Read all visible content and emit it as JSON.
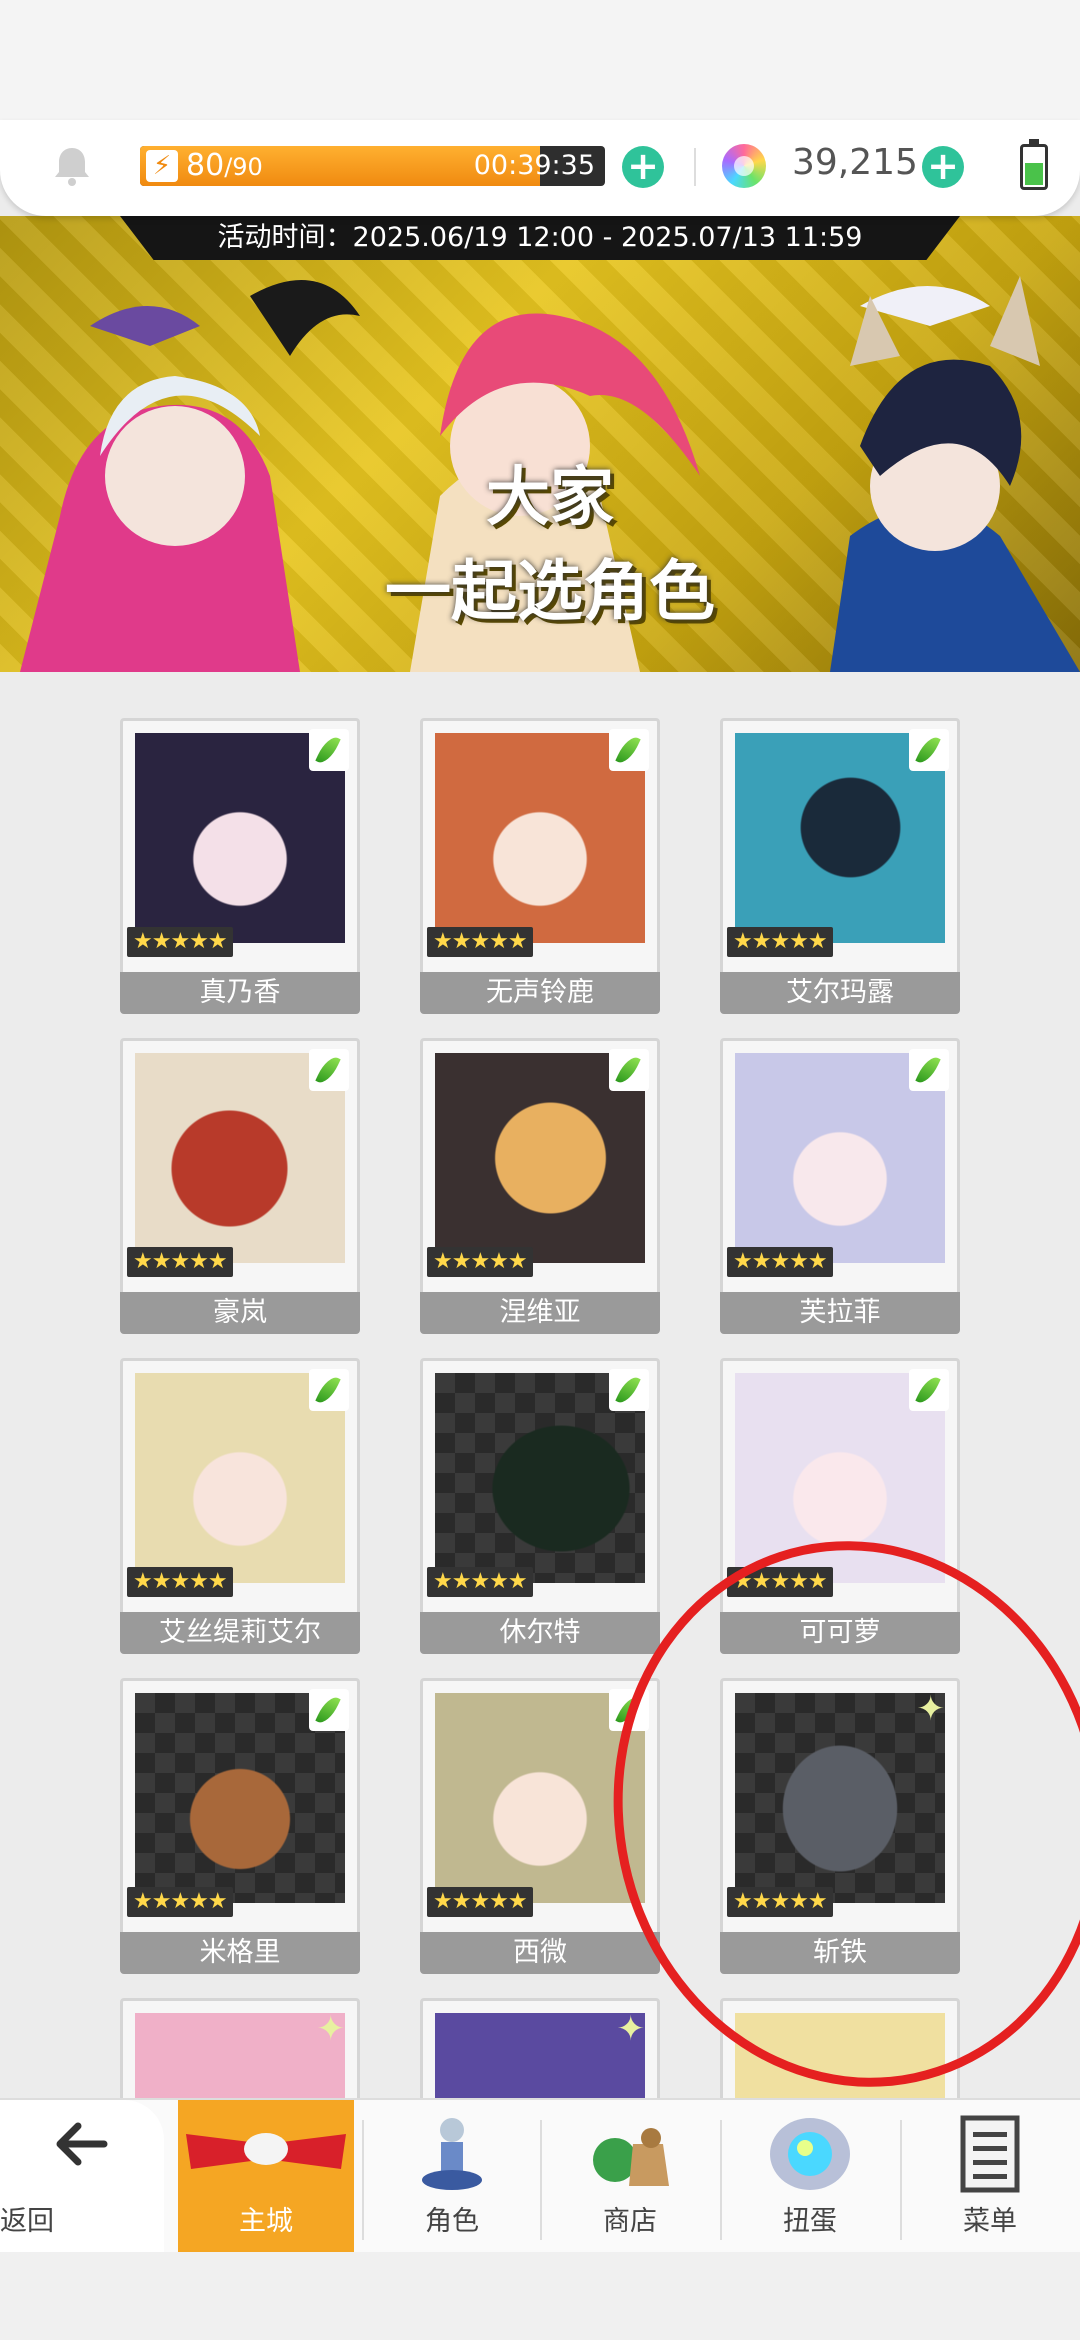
{
  "header": {
    "stamina": {
      "current": "80",
      "max": "/90",
      "timer": "00:39:35",
      "fill_fraction": 0.86
    },
    "gems": "39,215"
  },
  "banner": {
    "event_time": "活动时间：2025.06/19 12:00 - 2025.07/13 11:59",
    "title_line1": "大家",
    "title_line2": "一起选角色"
  },
  "characters": [
    {
      "name": "真乃香",
      "stars": "★★★★★",
      "badge": "leaf-icon",
      "color": "#2a2440"
    },
    {
      "name": "无声铃鹿",
      "stars": "★★★★★",
      "badge": "leaf-icon",
      "color": "#d06a40"
    },
    {
      "name": "艾尔玛露",
      "stars": "★★★★★",
      "badge": "leaf-icon",
      "color": "#3aa0b8"
    },
    {
      "name": "豪岚",
      "stars": "★★★★★",
      "badge": "leaf-icon",
      "color": "#b83a2a"
    },
    {
      "name": "涅维亚",
      "stars": "★★★★★",
      "badge": "leaf-icon",
      "color": "#d8a050"
    },
    {
      "name": "芙拉菲",
      "stars": "★★★★★",
      "badge": "leaf-icon",
      "color": "#c8c8e8"
    },
    {
      "name": "艾丝缇莉艾尔",
      "stars": "★★★★★",
      "badge": "leaf-icon",
      "color": "#e8dcb0"
    },
    {
      "name": "休尔特",
      "stars": "★★★★★",
      "badge": "leaf-icon",
      "color": "#2a3a30"
    },
    {
      "name": "可可萝",
      "stars": "★★★★★",
      "badge": "leaf-icon",
      "color": "#e8e0f0"
    },
    {
      "name": "米格里",
      "stars": "★★★★★",
      "badge": "leaf-icon",
      "color": "#6a4a30"
    },
    {
      "name": "西微",
      "stars": "★★★★★",
      "badge": "leaf-icon",
      "color": "#c0b890"
    },
    {
      "name": "斩铁",
      "stars": "★★★★★",
      "badge": "sparkle-icon",
      "color": "#5a5e66"
    },
    {
      "name": "",
      "stars": "★",
      "badge": "sparkle-icon",
      "color": "#f0b0c8"
    },
    {
      "name": "",
      "stars": "",
      "badge": "sparkle-icon",
      "color": "#5a4aa0"
    },
    {
      "name": "",
      "stars": "",
      "badge": "",
      "color": "#f0e0a0"
    }
  ],
  "nav": {
    "back": "返回",
    "items": [
      "主城",
      "角色",
      "商店",
      "扭蛋",
      "菜单"
    ]
  }
}
